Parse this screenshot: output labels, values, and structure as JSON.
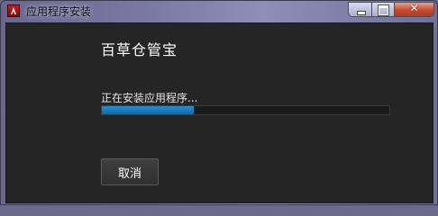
{
  "window": {
    "title": "应用程序安装",
    "icon": "adobe-air-icon",
    "controls": {
      "minimize": "minimize-icon",
      "maximize": "maximize-icon",
      "close": "close-icon"
    }
  },
  "main": {
    "app_name": "百草仓管宝",
    "status": "正在安装应用程序...",
    "progress": 0.32,
    "cancel_label": "取消"
  },
  "colors": {
    "progress_fill": "#1a78bd",
    "panel_background": "#252525"
  }
}
